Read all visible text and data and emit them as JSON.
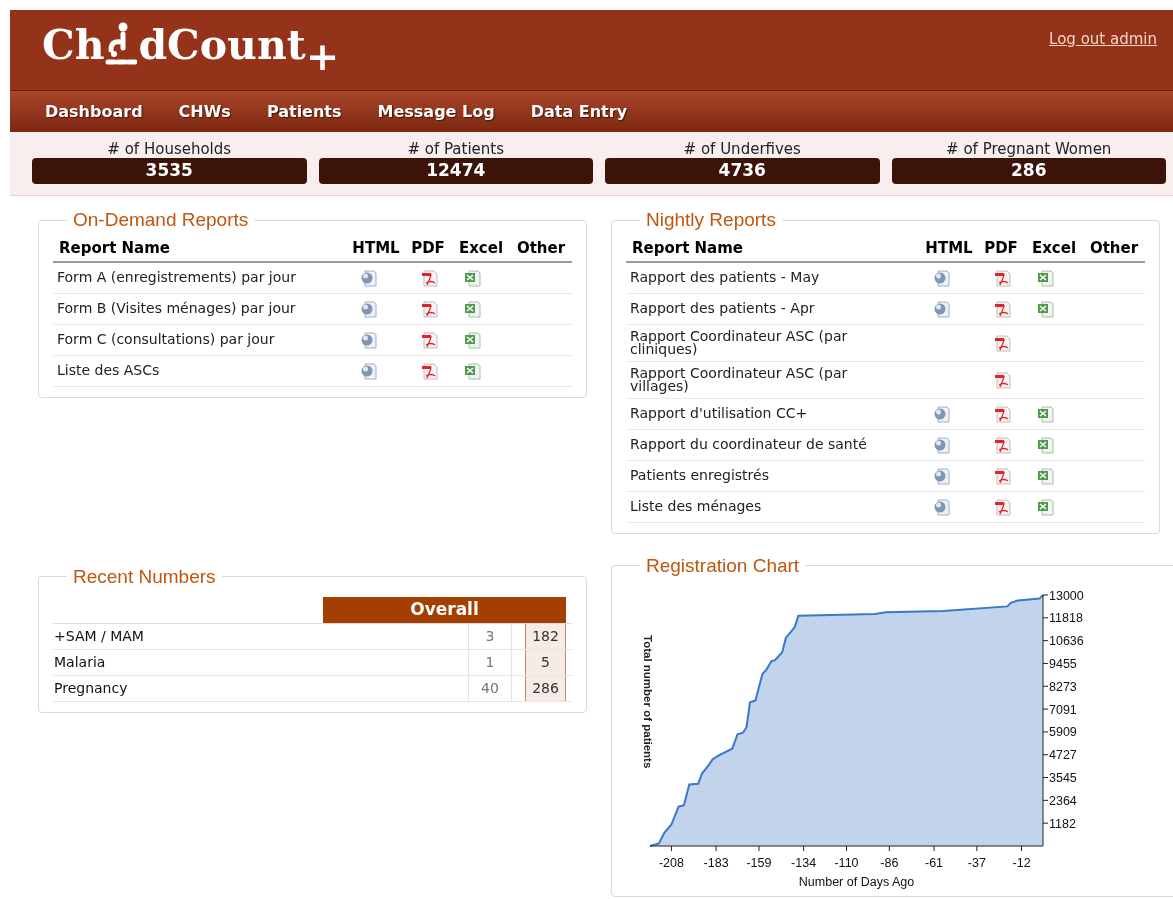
{
  "header": {
    "logo": {
      "before": "Ch",
      "after": "dCount",
      "suffix": "+"
    },
    "logout_link": "Log out admin"
  },
  "nav": [
    "Dashboard",
    "CHWs",
    "Patients",
    "Message Log",
    "Data Entry"
  ],
  "stats": [
    {
      "label": "# of Households",
      "value": "3535"
    },
    {
      "label": "# of Patients",
      "value": "12474"
    },
    {
      "label": "# of Underfives",
      "value": "4736"
    },
    {
      "label": "# of Pregnant Women",
      "value": "286"
    }
  ],
  "on_demand_reports": {
    "title": "On-Demand Reports",
    "columns": [
      "Report Name",
      "HTML",
      "PDF",
      "Excel",
      "Other"
    ],
    "rows": [
      {
        "name": "Form A (enregistrements) par jour",
        "html": true,
        "pdf": true,
        "excel": true
      },
      {
        "name": "Form B (Visites ménages) par jour",
        "html": true,
        "pdf": true,
        "excel": true
      },
      {
        "name": "Form C (consultations) par jour",
        "html": true,
        "pdf": true,
        "excel": true
      },
      {
        "name": "Liste des ASCs",
        "html": true,
        "pdf": true,
        "excel": true
      }
    ]
  },
  "nightly_reports": {
    "title": "Nightly Reports",
    "columns": [
      "Report Name",
      "HTML",
      "PDF",
      "Excel",
      "Other"
    ],
    "rows": [
      {
        "name": "Rapport des patients - May",
        "html": true,
        "pdf": true,
        "excel": true
      },
      {
        "name": "Rapport des patients - Apr",
        "html": true,
        "pdf": true,
        "excel": true
      },
      {
        "name": "Rapport Coordinateur ASC (par cliniques)",
        "html": false,
        "pdf": true,
        "excel": false
      },
      {
        "name": "Rapport Coordinateur ASC (par villages)",
        "html": false,
        "pdf": true,
        "excel": false
      },
      {
        "name": "Rapport d'utilisation CC+",
        "html": true,
        "pdf": true,
        "excel": true
      },
      {
        "name": "Rapport du coordinateur de santé",
        "html": true,
        "pdf": true,
        "excel": true
      },
      {
        "name": "Patients enregistrés",
        "html": true,
        "pdf": true,
        "excel": true
      },
      {
        "name": "Liste des ménages",
        "html": true,
        "pdf": true,
        "excel": true
      }
    ]
  },
  "recent_numbers": {
    "title": "Recent Numbers",
    "header": "Overall",
    "rows": [
      {
        "label": "+SAM / MAM",
        "recent": "3",
        "overall": "182"
      },
      {
        "label": "Malaria",
        "recent": "1",
        "overall": "5"
      },
      {
        "label": "Pregnancy",
        "recent": "40",
        "overall": "286"
      }
    ]
  },
  "registration_chart": {
    "title": "Registration Chart",
    "chart_data": {
      "type": "area",
      "xlabel": "Number of Days Ago",
      "ylabel": "Total number of patients",
      "x": [
        -220,
        -215,
        -212,
        -208,
        -204,
        -201,
        -198,
        -193,
        -191,
        -187,
        -185,
        -182,
        -174,
        -171,
        -168,
        -166,
        -164,
        -161,
        -157,
        -155,
        -152,
        -150,
        -146,
        -144,
        -139,
        -137,
        -94,
        -88,
        -56,
        -20,
        -18,
        -14,
        -2,
        0
      ],
      "series": [
        {
          "color": "#3a78c9",
          "values": [
            0,
            130,
            685,
            1111,
            2037,
            2111,
            3185,
            3222,
            3741,
            4204,
            4481,
            4667,
            5037,
            5778,
            5870,
            6148,
            7444,
            7537,
            8926,
            9111,
            9574,
            9630,
            10037,
            10778,
            11333,
            11926,
            12019,
            12111,
            12167,
            12407,
            12593,
            12722,
            12815,
            13000
          ]
        }
      ],
      "xlim": [
        -220,
        0
      ],
      "ylim": [
        0,
        13000
      ],
      "xticks": [
        -208,
        -183,
        -159,
        -134,
        -110,
        -86,
        -61,
        -37,
        -12
      ],
      "yticks": [
        1182,
        2364,
        3545,
        4727,
        5909,
        7091,
        8273,
        9455,
        10636,
        11818,
        13000
      ]
    }
  }
}
